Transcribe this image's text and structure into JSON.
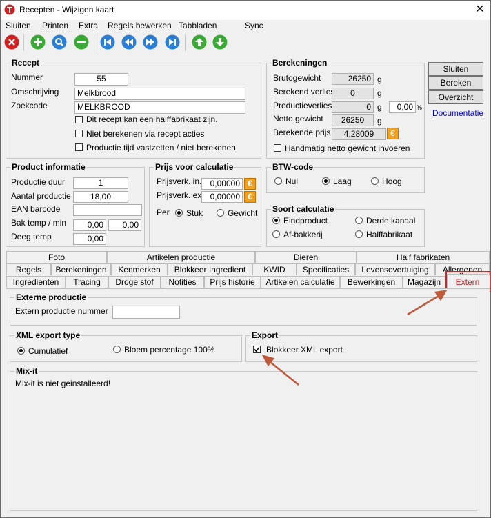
{
  "window": {
    "title": "Recepten - Wijzigen kaart",
    "close_symbol": "✕"
  },
  "menu": [
    {
      "label": "Sluiten"
    },
    {
      "label": "Printen"
    },
    {
      "label": "Extra"
    },
    {
      "label": "Regels bewerken"
    },
    {
      "label": "Tabbladen"
    },
    {
      "label": "Sync"
    }
  ],
  "toolbar_icons": [
    "delete-icon",
    "add-icon",
    "search-icon",
    "remove-icon",
    "first-record-icon",
    "previous-record-icon",
    "next-record-icon",
    "last-record-icon",
    "move-up-icon",
    "move-down-icon"
  ],
  "recept": {
    "title": "Recept",
    "nummer_label": "Nummer",
    "nummer": "55",
    "omschrijving_label": "Omschrijving",
    "omschrijving": "Melkbrood",
    "zoekcode_label": "Zoekcode",
    "zoekcode": "MELKBROOD",
    "check1": "Dit recept kan een halffabrikaat zijn.",
    "check2": "Niet berekenen via recept acties",
    "check3": "Productie tijd vastzetten / niet berekenen"
  },
  "berekeningen": {
    "title": "Berekeningen",
    "brutogewicht_label": "Brutogewicht",
    "brutogewicht": "26250",
    "brutogewicht_unit": "g",
    "verlies_label": "Berekend verlies",
    "verlies": "0",
    "verlies_unit": "g",
    "productieverlies_label": "Productieverlies",
    "productieverlies": "0",
    "productieverlies_unit": "g",
    "productieverlies_pct": "0,00",
    "pct_unit": "%",
    "netto_label": "Netto gewicht",
    "netto": "26250",
    "netto_unit": "g",
    "prijs_label": "Berekende prijs",
    "prijs": "4,28009",
    "handmatig": "Handmatig netto gewicht invoeren"
  },
  "side_buttons": {
    "sluiten": "Sluiten",
    "bereken": "Bereken",
    "overzicht": "Overzicht",
    "documentatie": "Documentatie"
  },
  "product_info": {
    "title": "Product informatie",
    "duur_label": "Productie duur",
    "duur": "1",
    "aantal_label": "Aantal productie",
    "aantal": "18,00",
    "ean_label": "EAN barcode",
    "ean": "",
    "bak_label": "Bak temp / min",
    "bak1": "0,00",
    "bak2": "0,00",
    "deeg_label": "Deeg temp",
    "deeg": "0,00"
  },
  "prijs_calc": {
    "title": "Prijs voor calculatie",
    "in_label": "Prijsverk. in.",
    "in": "0,00000",
    "ex_label": "Prijsverk. ex.",
    "ex": "0,00000",
    "per_label": "Per",
    "stuk": "Stuk",
    "gewicht": "Gewicht"
  },
  "btw": {
    "title": "BTW-code",
    "nul": "Nul",
    "laag": "Laag",
    "hoog": "Hoog"
  },
  "soort": {
    "title": "Soort calculatie",
    "eind": "Eindproduct",
    "derde": "Derde kanaal",
    "af": "Af-bakkerij",
    "half": "Halffabrikaat"
  },
  "tabs_row1": [
    "Foto",
    "Artikelen productie",
    "Dieren",
    "Half fabrikaten"
  ],
  "tabs_row2": [
    "Regels",
    "Berekeningen",
    "Kenmerken",
    "Blokkeer Ingredient",
    "KWID",
    "Specificaties",
    "Levensovertuiging",
    "Allergenen"
  ],
  "tabs_row3": [
    "Ingredienten",
    "Tracing",
    "Droge stof",
    "Notities",
    "Prijs historie",
    "Artikelen calculatie",
    "Bewerkingen",
    "Magazijn",
    "Extern"
  ],
  "extern": {
    "externe_title": "Externe productie",
    "extern_nummer_label": "Extern productie nummer",
    "extern_nummer": "",
    "xml_title": "XML export type",
    "cumulatief": "Cumulatief",
    "bloem": "Bloem percentage 100%",
    "export_title": "Export",
    "blokkeer": "Blokkeer XML export",
    "mixit_title": "Mix-it",
    "mixit_msg": "Mix-it is niet geinstalleerd!"
  },
  "colors": {
    "highlight": "#c0282b",
    "arrow": "#c0593a",
    "euro": "#f0a020",
    "green": "#3aa935",
    "blue": "#2a7fd4",
    "red": "#d32121"
  }
}
